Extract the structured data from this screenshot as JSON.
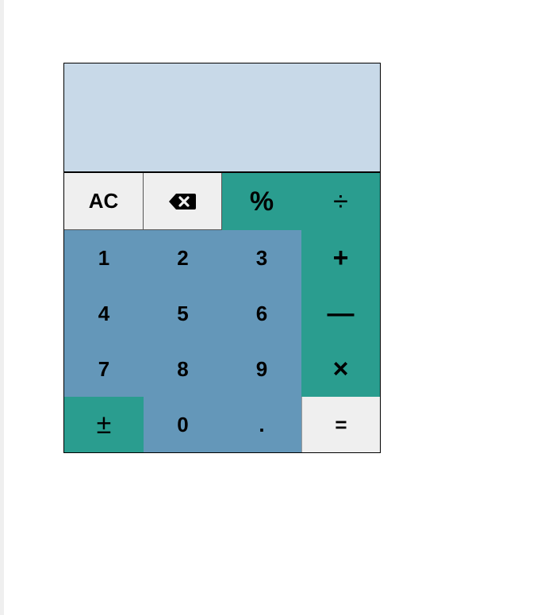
{
  "colors": {
    "display_bg": "#c8d9e8",
    "light_key_bg": "#efefef",
    "operator_key_bg": "#2a9d8f",
    "number_key_bg": "#6497b9"
  },
  "display": {
    "value": ""
  },
  "keys": {
    "clear": "AC",
    "backspace_icon": "backspace-icon",
    "percent": "%",
    "divide": "÷",
    "one": "1",
    "two": "2",
    "three": "3",
    "plus": "+",
    "four": "4",
    "five": "5",
    "six": "6",
    "minus": "—",
    "seven": "7",
    "eight": "8",
    "nine": "9",
    "multiply": "×",
    "plus_minus": "±",
    "zero": "0",
    "decimal": ".",
    "equals": "="
  }
}
